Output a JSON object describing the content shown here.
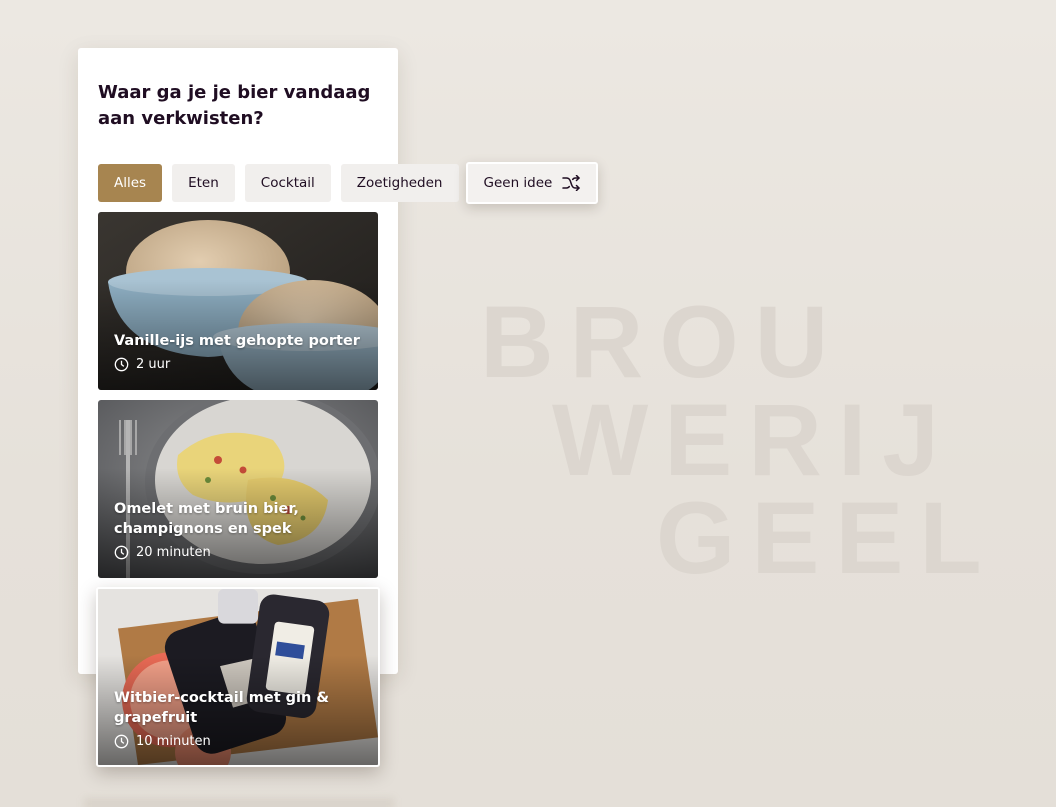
{
  "brand": {
    "watermark_lines": [
      "BROU",
      "WERIJ",
      "GEEL"
    ]
  },
  "question": "Waar ga je je bier vandaag aan verkwisten?",
  "filters": [
    {
      "label": "Alles",
      "active": true
    },
    {
      "label": "Eten",
      "active": false
    },
    {
      "label": "Cocktail",
      "active": false
    },
    {
      "label": "Zoetigheden",
      "active": false
    }
  ],
  "random_button": {
    "label": "Geen idee",
    "icon": "shuffle-icon"
  },
  "recipes": [
    {
      "title": "Vanille-ijs met gehopte porter",
      "time": "2 uur",
      "icon": "clock-icon"
    },
    {
      "title": "Omelet met bruin bier, champignons en spek",
      "time": "20 minuten",
      "icon": "clock-icon"
    },
    {
      "title": "Witbier-cocktail met gin & grapefruit",
      "time": "10 minuten",
      "icon": "clock-icon"
    }
  ],
  "colors": {
    "accent": "#a78550",
    "text": "#1f0d22",
    "chip_bg": "#f1efed",
    "background": "#e9e5df"
  }
}
